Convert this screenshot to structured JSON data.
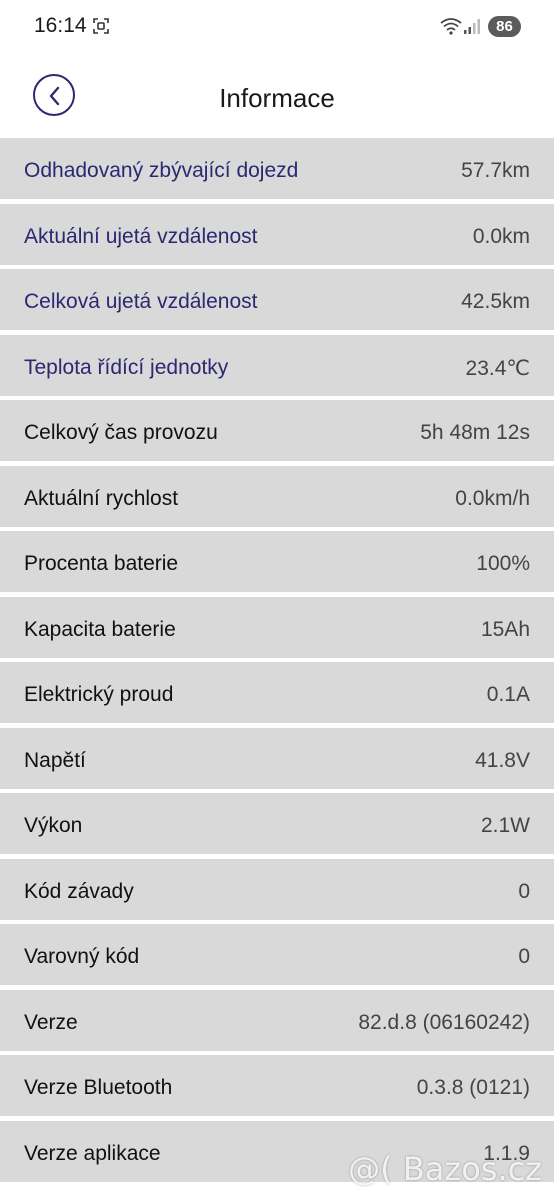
{
  "status_bar": {
    "time": "16:14",
    "battery": "86",
    "icons": [
      "screenshot-icon",
      "wifi-icon",
      "signal-icon"
    ]
  },
  "header": {
    "title": "Informace",
    "back_icon": "chevron-left-icon"
  },
  "colors": {
    "accent": "#2b2872",
    "row_background": "#d9d9d9"
  },
  "rows": [
    {
      "label": "Odhadovaný zbývající dojezd",
      "value": "57.7km",
      "accent": true
    },
    {
      "label": "Aktuální ujetá vzdálenost",
      "value": "0.0km",
      "accent": true
    },
    {
      "label": "Celková ujetá vzdálenost",
      "value": "42.5km",
      "accent": true
    },
    {
      "label": "Teplota řídící jednotky",
      "value": "23.4℃",
      "accent": true
    },
    {
      "label": "Celkový čas provozu",
      "value": "5h 48m 12s",
      "accent": false
    },
    {
      "label": "Aktuální rychlost",
      "value": "0.0km/h",
      "accent": false
    },
    {
      "label": "Procenta baterie",
      "value": "100%",
      "accent": false
    },
    {
      "label": "Kapacita baterie",
      "value": "15Ah",
      "accent": false
    },
    {
      "label": "Elektrický proud",
      "value": "0.1A",
      "accent": false
    },
    {
      "label": "Napětí",
      "value": "41.8V",
      "accent": false
    },
    {
      "label": "Výkon",
      "value": "2.1W",
      "accent": false
    },
    {
      "label": "Kód závady",
      "value": "0",
      "accent": false
    },
    {
      "label": "Varovný kód",
      "value": "0",
      "accent": false
    },
    {
      "label": "Verze",
      "value": "82.d.8 (06160242)",
      "accent": false
    },
    {
      "label": "Verze Bluetooth",
      "value": "0.3.8 (0121)",
      "accent": false
    },
    {
      "label": "Verze aplikace",
      "value": "1.1.9",
      "accent": false
    }
  ],
  "watermark": "@( Bazos.cz"
}
